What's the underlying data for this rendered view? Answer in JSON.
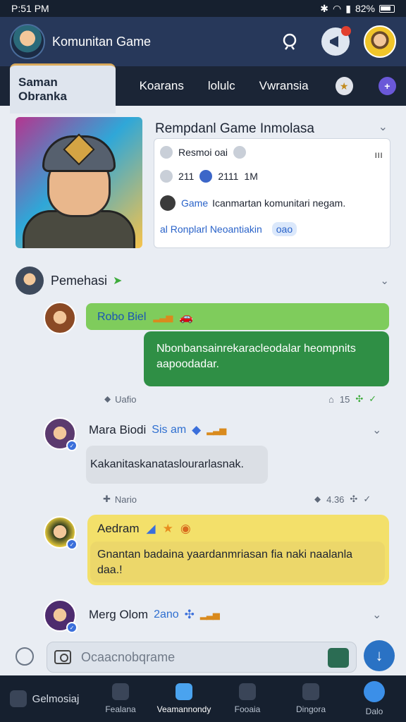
{
  "status_bar": {
    "time": "P:51 PM",
    "battery": "82%"
  },
  "header": {
    "title": "Komunitan Game"
  },
  "tabs": [
    {
      "label": "Saman Obranka",
      "active": true
    },
    {
      "label": "Koarans"
    },
    {
      "label": "lolulc"
    },
    {
      "label": "Vwransia"
    }
  ],
  "feature": {
    "title": "Rempdanl Game Inmolasa",
    "row1_label": "Resmoi oai",
    "menu_label": "ııı",
    "stat1": "211",
    "stat2": "2111",
    "stat3": "1M",
    "game_link": "Game",
    "description": "Icanmartan komunitari negam.",
    "tags_label": "al Ronplarl Neoantiakin",
    "tag_pill": "oao"
  },
  "section": {
    "title": "Pemehasi"
  },
  "messages": [
    {
      "name": "Robo Biel",
      "text": "Nbonbansainrekaracleodalar heompnits aapoodadar.",
      "meta_left": "Uafio",
      "meta_right": "15"
    },
    {
      "name": "Mara Biodi",
      "sub": "Sis am",
      "text": "Kakanitaskanataslourarlasnak.",
      "meta_left": "Nario",
      "meta_right": "4.36"
    },
    {
      "name": "Aedram",
      "text": "Gnantan badaina yaardanmriasan fia naki naalanla daa.!",
      "text_line2": "daa.!"
    },
    {
      "name": "Merg Olom",
      "sub": "2ano"
    }
  ],
  "compose": {
    "placeholder": "Ocaacnobqrame"
  },
  "bottom_nav": [
    {
      "label": "Gelmosiaj"
    },
    {
      "label": "Fealana"
    },
    {
      "label": "Veamannondy",
      "active": true
    },
    {
      "label": "Fooaia"
    },
    {
      "label": "Dingora"
    },
    {
      "label": "Dalo"
    }
  ]
}
